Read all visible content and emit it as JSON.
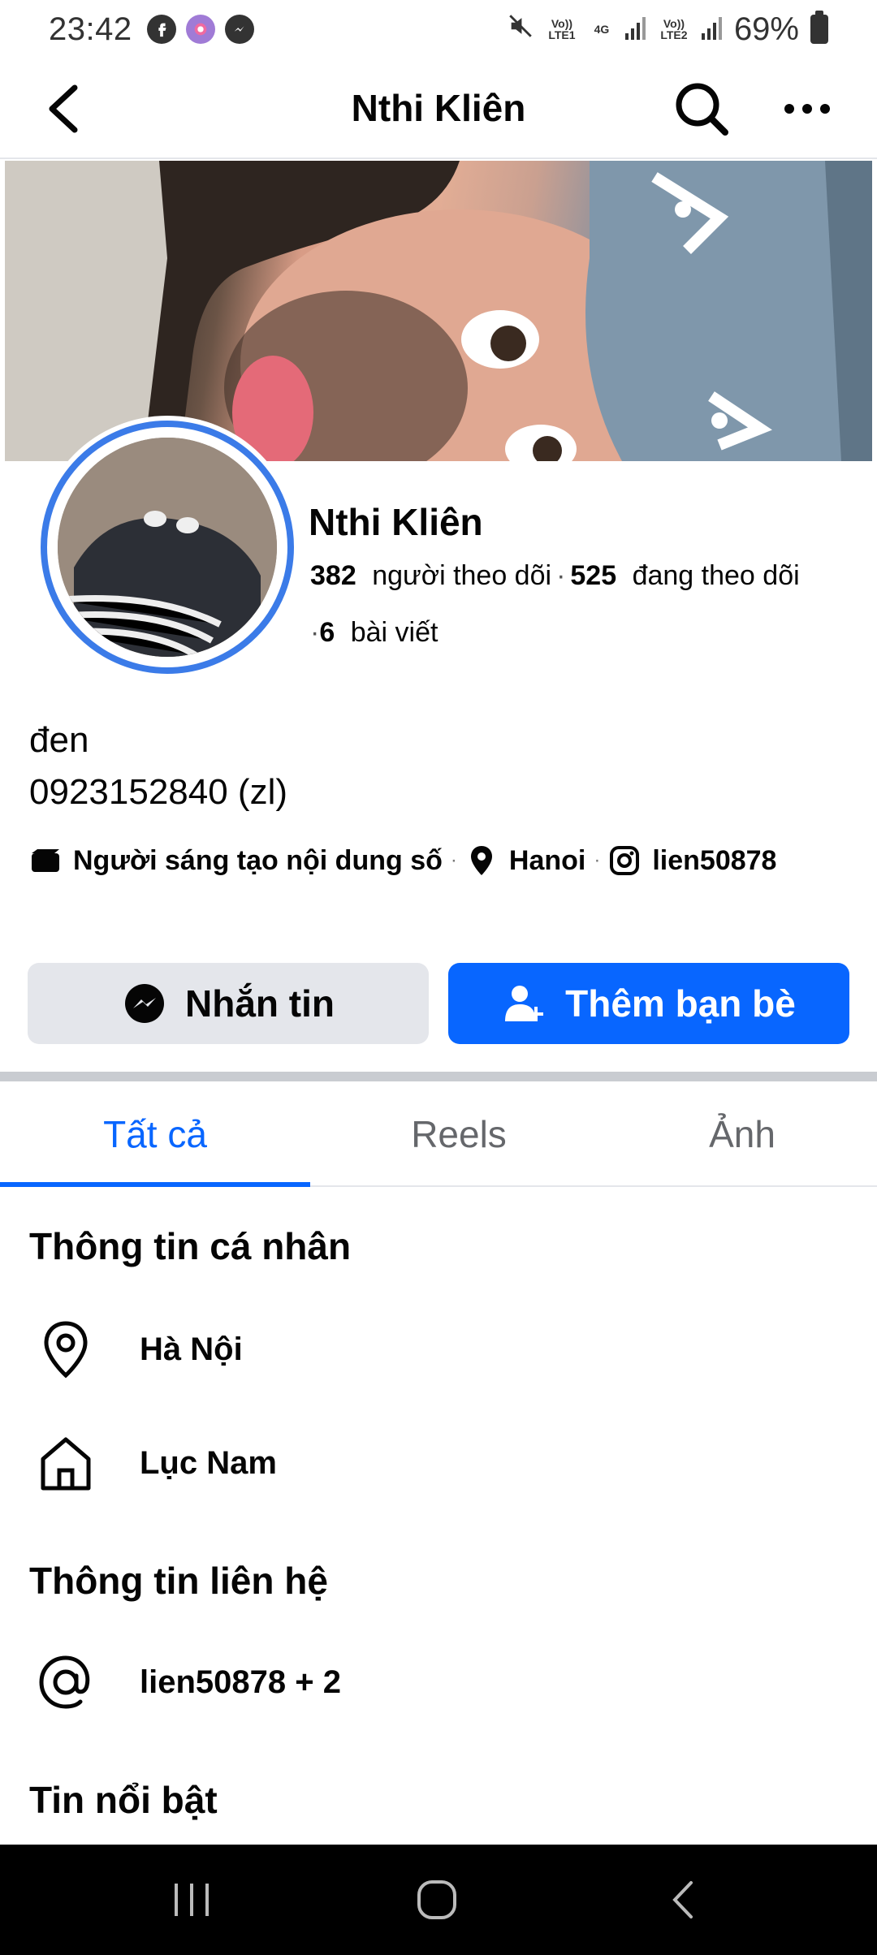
{
  "status_bar": {
    "time": "23:42",
    "battery": "69%",
    "sim1_label": "Vo)) LTE1",
    "sim2_label": "Vo)) LTE2",
    "network": "4G"
  },
  "header": {
    "title": "Nthi Kliên"
  },
  "profile": {
    "name": "Nthi Kliên",
    "followers_count": "382",
    "followers_label": "người theo dõi",
    "following_count": "525",
    "following_label": "đang theo dõi",
    "posts_count": "6",
    "posts_label": "bài viết",
    "bio_line1": "đen",
    "bio_line2": "0923152840 (zl)",
    "category": "Người sáng tạo nội dung số",
    "location": "Hanoi",
    "instagram": "lien50878"
  },
  "actions": {
    "message_label": "Nhắn tin",
    "add_friend_label": "Thêm bạn bè"
  },
  "tabs": [
    {
      "label": "Tất cả",
      "active": true
    },
    {
      "label": "Reels",
      "active": false
    },
    {
      "label": "Ảnh",
      "active": false
    }
  ],
  "personal_info": {
    "title": "Thông tin cá nhân",
    "current_city": "Hà Nội",
    "hometown": "Lục Nam"
  },
  "contact_info": {
    "title": "Thông tin liên hệ",
    "handle": "lien50878 + 2"
  },
  "featured": {
    "title": "Tin nổi bật"
  },
  "colors": {
    "accent": "#0866ff",
    "avatar_ring": "#3b7be8",
    "secondary_button": "#e4e6eb"
  }
}
